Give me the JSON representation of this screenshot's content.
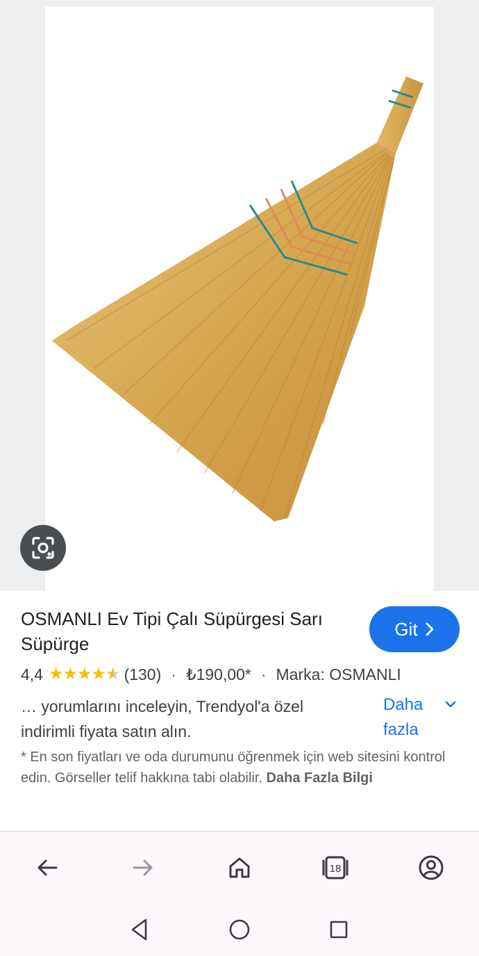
{
  "result": {
    "title": "OSMANLI Ev Tipi Çalı Süpürgesi Sarı Süpürge",
    "go_label": "Git",
    "rating": "4,4",
    "rating_value": 4.4,
    "review_count": "(130)",
    "price": "₺190,00*",
    "brand": "Marka: OSMANLI",
    "description": "… yorumlarını inceleyin, Trendyol'a özel indirimli fiyata satın alın.",
    "more_label": "Daha fazla",
    "disclaimer": "* En son fiyatları ve oda durumunu öğrenmek için web sitesini kontrol edin. Görseller telif hakkına tabi olabilir.",
    "disclaimer_link": "Daha Fazla Bilgi"
  },
  "browser_nav": {
    "tab_count": "18",
    "icons": [
      "back-arrow-icon",
      "forward-arrow-icon",
      "home-icon",
      "tabs-icon",
      "account-icon"
    ]
  },
  "system_nav": {
    "icons": [
      "back-triangle-icon",
      "home-circle-icon",
      "recents-square-icon"
    ]
  },
  "colors": {
    "accent": "#1a73e8",
    "star": "#fbbc04",
    "lens_button": "#4a4d51",
    "broom_straw": "#d9ac5a",
    "broom_twine": "#2a8a8a"
  }
}
